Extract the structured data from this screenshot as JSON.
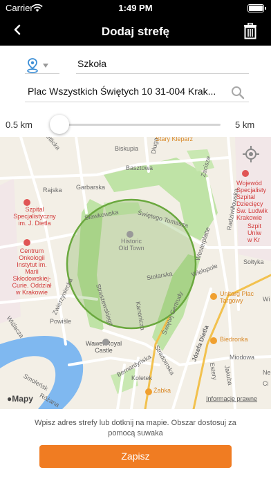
{
  "status_bar": {
    "carrier": "Carrier",
    "time": "1:49 PM"
  },
  "nav": {
    "title": "Dodaj strefę",
    "back_icon": "chevron-left-icon",
    "delete_icon": "trash-icon"
  },
  "form": {
    "type_icon": "location-pin-icon",
    "zone_name": "Szkoła",
    "address": "Plac Wszystkich Świętych 10 31-004 Krak...",
    "search_icon": "magnifier-icon"
  },
  "radius_slider": {
    "min_label": "0.5 km",
    "max_label": "5 km",
    "value_fraction": 0.0
  },
  "map": {
    "brand": "Mapy",
    "attribution": "Informacje prawne",
    "zone_circle_color": "#6aa83e",
    "labels": {
      "metlicka": "metlicka",
      "biskupia": "Biskupia",
      "dluga": "Długa",
      "stary_kleparz": "Stary Kleparz",
      "basztowa": "Basztowa",
      "zacisze": "Zacisze",
      "rajska": "Rajska",
      "garbarska": "Garbarska",
      "slawkowska": "Sławkowska",
      "swietego_tomasza": "Świętego Tomasza",
      "westerplatte": "Westerplatte",
      "radziwillowska": "Radziwiłłowska",
      "szpital_dietla": "Szpital\nSpecjalistyczny\nim. J. Dietla",
      "centrum_onkologii": "Centrum\nOnkologii\nInstytut im.\nMarii\nSkłodowskiej-\nCurie. Oddział\nw Krakowie",
      "historic_old_town": "Historic\nOld Town",
      "stolarska": "Stolarska",
      "wielopole": "Wielopole",
      "sołtyka": "Sołtyka",
      "zwierzyniecka": "Zwierzyniecka",
      "straszewskiego": "Straszewskiego",
      "swietej_gertrudy": "Świętej Gertrudy",
      "kanonicza": "Kanonicza",
      "powisle": "Powiśle",
      "wawel": "Wawel Royal\nCastle",
      "unitarg": "Unitarg Plac\nTargowy",
      "biedronka": "Biedronka",
      "wojewodzki_szpital": "Wojewód\nSpecjalisty\nSzpital\nDziecięcy\nŚw. Ludwik\nKrakowie",
      "szpital_right": "Szpit\nUniw\nw Kr",
      "wiślacza": "Wiślacza",
      "bernardynska": "Bernardyńska",
      "stradomska": "Stradomska",
      "jozefa_dietla": "Józefa Dietla",
      "miodowa": "Miodowa",
      "estery": "Estery",
      "koletek": "Koletek",
      "zabka": "Żabka",
      "smolensk": "Smoleńsk",
      "rozana": "Różana",
      "jakuba": "Jakuba",
      "ne": "Ne",
      "ci": "Ci",
      "wi": "Wi"
    }
  },
  "hint": "Wpisz adres strefy lub dotknij na mapie. Obszar dostosuj za pomocą suwaka",
  "save_label": "Zapisz",
  "colors": {
    "accent": "#f07c22",
    "slider": "#2a8cff",
    "bar": "#000000"
  }
}
